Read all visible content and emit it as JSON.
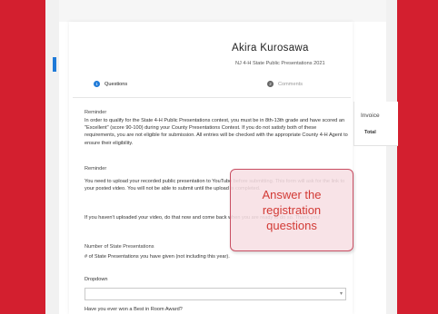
{
  "header": {
    "name": "Akira Kurosawa",
    "subtitle": "NJ 4-H State Public Presentations 2021"
  },
  "steps": [
    {
      "number": "1",
      "label": "Questions"
    },
    {
      "number": "2",
      "label": "Comments"
    }
  ],
  "invoice": {
    "title": "Invoice",
    "total_label": "Total"
  },
  "sections": {
    "reminder1_heading": "Reminder",
    "reminder1_text": "In order to qualify for the State 4-H Public Presentations contest, you must be in 8th-13th grade and have scored an \"Excellent\" (score 90-100) during your County Presentations Contest. If you do not satisfy both of these requirements, you are not eligible for submission. All entries will be checked with the appropriate County 4-H Agent to ensure their eligibility.",
    "reminder2_heading": "Reminder",
    "reminder2_text": "You need to upload your recorded public presentation to YouTube before submitting. This form will ask for the link to your posted video. You will not be able to submit until the upload is completed.",
    "reminder2_followup": "If you haven't uploaded your video, do that now and come back when you are ready to do so. Thank you!",
    "state_heading": "Number of State Presentations",
    "state_text": "# of State Presentations you have given (not including this year).",
    "dropdown_label": "Dropdown",
    "best_in_room": "Have you ever won a Best in Room Award?"
  },
  "overlay": {
    "text": "Answer the registration questions"
  }
}
